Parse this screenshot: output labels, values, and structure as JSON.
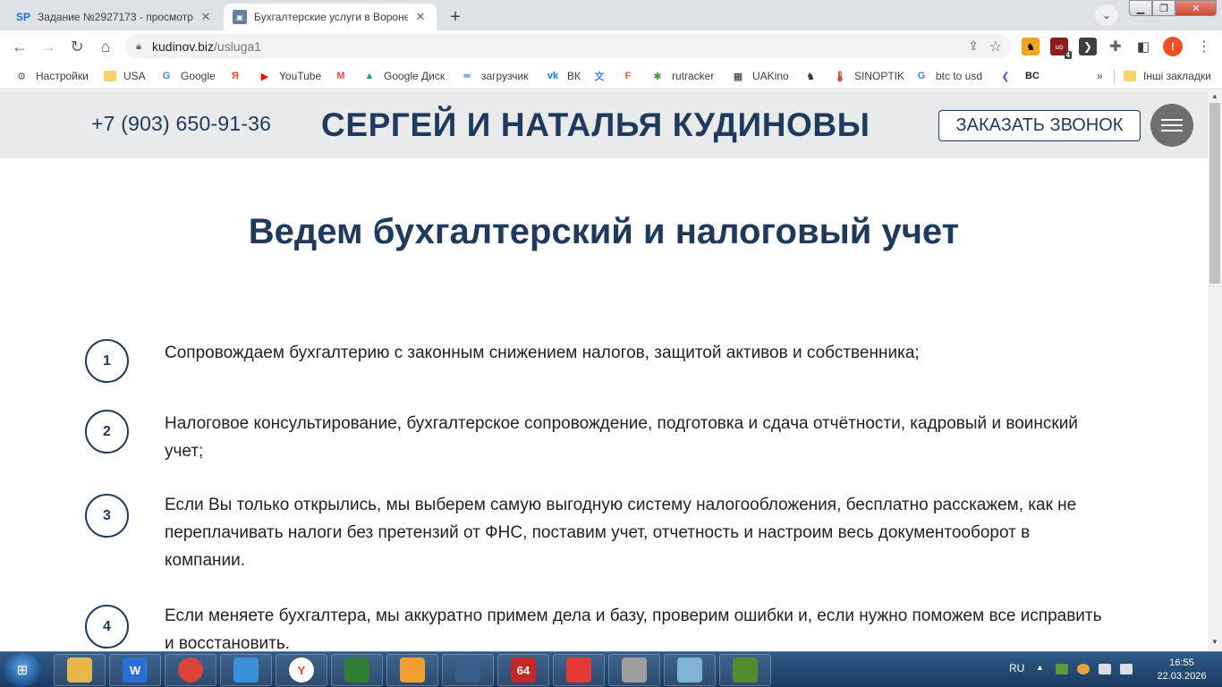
{
  "browser": {
    "tabs": [
      {
        "favicon": "SP",
        "title": "Задание №2927173 - просмотр"
      },
      {
        "favicon": "site-favicon",
        "title": "Бухгалтерские услуги в Воронеж"
      }
    ],
    "new_tab": "+",
    "url_host": "kudinov.biz",
    "url_path": "/usluga1",
    "profile_initial": "!",
    "ext_badge": "4"
  },
  "bookmarks": [
    {
      "label": "Настройки",
      "icon": "gear-icon",
      "color": "#5f6368"
    },
    {
      "label": "USA",
      "icon": "folder-icon",
      "color": "#f9d36a"
    },
    {
      "label": "Google",
      "icon": "google-icon",
      "color": "#4285f4"
    },
    {
      "label": "",
      "icon": "yandex-icon",
      "color": "#fc3f1d"
    },
    {
      "label": "YouTube",
      "icon": "youtube-icon",
      "color": "#ff0000"
    },
    {
      "label": "",
      "icon": "gmail-icon",
      "color": "#ea4335"
    },
    {
      "label": "Google Диск",
      "icon": "drive-icon",
      "color": "#1fa463"
    },
    {
      "label": "загрузчик",
      "icon": "loader-icon",
      "color": "#2b79e8"
    },
    {
      "label": "ВК",
      "icon": "vk-icon",
      "color": "#0077ff"
    },
    {
      "label": "",
      "icon": "translate-icon",
      "color": "#4285f4"
    },
    {
      "label": "",
      "icon": "f-icon",
      "color": "#f05a28"
    },
    {
      "label": "rutracker",
      "icon": "rutracker-icon",
      "color": "#3b9b3b"
    },
    {
      "label": "UAKino",
      "icon": "uakino-icon",
      "color": "#222222"
    },
    {
      "label": "",
      "icon": "chess-icon",
      "color": "#333333"
    },
    {
      "label": "SINOPTIK",
      "icon": "thermometer-icon",
      "color": "#c0392b"
    },
    {
      "label": "btc to usd",
      "icon": "google-icon",
      "color": "#4285f4"
    },
    {
      "label": "",
      "icon": "arrow-icon",
      "color": "#3b5bdb"
    },
    {
      "label": "",
      "icon": "bc-icon",
      "color": "#222222"
    }
  ],
  "bookmarks_more": "»",
  "other_bookmarks": "Інші закладки",
  "site": {
    "phone": "+7 (903) 650-91-36",
    "brand": "СЕРГЕЙ И НАТАЛЬЯ КУДИНОВЫ",
    "callback_label": "ЗАКАЗАТЬ ЗВОНОК",
    "section_title": "Ведем бухгалтерский и налоговый учет",
    "items": [
      {
        "num": "1",
        "text": "Сопровождаем бухгалтерию с законным снижением налогов, защитой активов и собственника;"
      },
      {
        "num": "2",
        "text": "Налоговое консультирование, бухгалтерское сопровождение, подготовка и сдача отчётности, кадровый и воинский учет;"
      },
      {
        "num": "3",
        "text": "Если Вы только открылись, мы выберем самую выгодную систему налогообложения, бесплатно расскажем, как не переплачивать налоги без претензий от ФНС, поставим учет, отчетность и настроим весь документооборот в компании."
      },
      {
        "num": "4",
        "text": "Если меняете бухгалтера, мы аккуратно примем дела и базу, проверим ошибки и, если нужно поможем все исправить и восстановить."
      }
    ]
  },
  "taskbar": {
    "apps": [
      {
        "icon": "explorer-icon",
        "label": "",
        "color": "#e5b74a"
      },
      {
        "icon": "wise-icon",
        "label": "W",
        "color": "#2a6fd6"
      },
      {
        "icon": "chrome-icon",
        "label": "",
        "color": "#db4437"
      },
      {
        "icon": "globe-icon",
        "label": "",
        "color": "#3a8fd9"
      },
      {
        "icon": "yandex-browser-icon",
        "label": "Y",
        "color": "#ffffff"
      },
      {
        "icon": "excel-icon",
        "label": "",
        "color": "#2e7d32"
      },
      {
        "icon": "player-icon",
        "label": "",
        "color": "#f0a030"
      },
      {
        "icon": "clock-icon",
        "label": "",
        "color": "#3a5f8a"
      },
      {
        "icon": "app-64-icon",
        "label": "64",
        "color": "#c62828"
      },
      {
        "icon": "chart-icon",
        "label": "",
        "color": "#e53935"
      },
      {
        "icon": "calculator-icon",
        "label": "",
        "color": "#9e9e9e"
      },
      {
        "icon": "notepad-icon",
        "label": "",
        "color": "#7fb3d5"
      },
      {
        "icon": "monitor-icon",
        "label": "",
        "color": "#558b2f"
      }
    ],
    "lang": "RU",
    "time": "16:55",
    "date": "22.03.2026"
  }
}
